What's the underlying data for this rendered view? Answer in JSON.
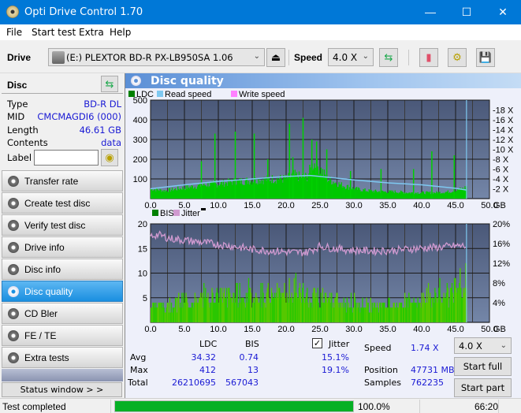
{
  "window": {
    "title": "Opti Drive Control 1.70",
    "controls": {
      "minimize": "—",
      "maximize": "☐",
      "close": "✕"
    }
  },
  "menu": [
    "File",
    "Start test",
    "Extra",
    "Help"
  ],
  "toolbar": {
    "drive_label": "Drive",
    "drive_value": "(E:)  PLEXTOR BD-R  PX-LB950SA 1.06",
    "speed_label": "Speed",
    "speed_value": "4.0 X",
    "icons": [
      "eject-icon",
      "refresh-icon",
      "eraser-icon",
      "settings-icon",
      "save-icon"
    ]
  },
  "disc": {
    "title": "Disc",
    "rows": [
      {
        "key": "Type",
        "value": "BD-R DL"
      },
      {
        "key": "MID",
        "value": "CMCMAGDI6 (000)"
      },
      {
        "key": "Length",
        "value": "46.61 GB"
      },
      {
        "key": "Contents",
        "value": "data"
      }
    ],
    "label_key": "Label",
    "label_value": ""
  },
  "nav": [
    {
      "label": "Transfer rate",
      "active": false
    },
    {
      "label": "Create test disc",
      "active": false
    },
    {
      "label": "Verify test disc",
      "active": false
    },
    {
      "label": "Drive info",
      "active": false
    },
    {
      "label": "Disc info",
      "active": false
    },
    {
      "label": "Disc quality",
      "active": true
    },
    {
      "label": "CD Bler",
      "active": false
    },
    {
      "label": "FE / TE",
      "active": false
    },
    {
      "label": "Extra tests",
      "active": false
    }
  ],
  "status_window_label": "Status window > >",
  "panel_title": "Disc quality",
  "colors": {
    "accent": "#0078d7",
    "ldc": "#00c800",
    "read_speed": "#7ec8f0",
    "write_speed": "#ff80ff",
    "bis": "#008000",
    "jitter": "#d09ad0",
    "progress": "#06b025",
    "value_text": "#1a1ad4"
  },
  "chart_data": [
    {
      "type": "bar",
      "title": "LDC / Read speed",
      "legend": [
        "LDC",
        "Read speed",
        "Write speed"
      ],
      "legend_position": "top-left",
      "xlabel": "GB",
      "x_ticks": [
        "0.0",
        "5.0",
        "10.0",
        "15.0",
        "20.0",
        "25.0",
        "30.0",
        "35.0",
        "40.0",
        "45.0",
        "50.0"
      ],
      "xlim": [
        0,
        50
      ],
      "y_left_ticks": [
        "100",
        "200",
        "300",
        "400",
        "500"
      ],
      "ylim_left": [
        0,
        500
      ],
      "y_right_ticks": [
        "2 X",
        "4 X",
        "6 X",
        "8 X",
        "10 X",
        "12 X",
        "14 X",
        "16 X",
        "18 X"
      ],
      "ylim_right": [
        0,
        20
      ],
      "grid": true,
      "end_marker_gb": 46.61,
      "series": [
        {
          "name": "LDC",
          "x": [
            0,
            2,
            4,
            6,
            8,
            10,
            12,
            14,
            16,
            18,
            20,
            21,
            22,
            23,
            24,
            25,
            26,
            28,
            30,
            32,
            34,
            36,
            38,
            40,
            42,
            44,
            46,
            46.6
          ],
          "values": [
            50,
            40,
            50,
            60,
            70,
            75,
            85,
            90,
            95,
            100,
            100,
            120,
            110,
            110,
            180,
            150,
            100,
            70,
            50,
            40,
            35,
            35,
            30,
            30,
            30,
            35,
            50,
            60
          ]
        },
        {
          "name": "LDC spikes",
          "x": [
            7.5,
            9.5,
            12.5,
            15.3,
            17.3,
            20.5,
            21,
            22.5,
            23.8,
            24.5,
            26,
            29.5,
            34,
            38.8,
            41.5,
            44.8
          ],
          "values": [
            190,
            330,
            340,
            330,
            200,
            380,
            210,
            410,
            300,
            290,
            250,
            140,
            150,
            150,
            240,
            220
          ]
        },
        {
          "name": "Read speed",
          "x": [
            0,
            5,
            10,
            15,
            20,
            23.5,
            25,
            30,
            35,
            40,
            45,
            46.6
          ],
          "values": [
            2.0,
            2.8,
            3.5,
            4.0,
            4.5,
            4.7,
            4.5,
            3.8,
            3.2,
            2.8,
            2.1,
            1.74
          ]
        }
      ]
    },
    {
      "type": "bar",
      "title": "BIS / Jitter",
      "legend": [
        "BIS",
        "Jitter"
      ],
      "legend_position": "top-left",
      "xlabel": "GB",
      "x_ticks": [
        "0.0",
        "5.0",
        "10.0",
        "15.0",
        "20.0",
        "25.0",
        "30.0",
        "35.0",
        "40.0",
        "45.0",
        "50.0"
      ],
      "xlim": [
        0,
        50
      ],
      "y_left_ticks": [
        "5",
        "10",
        "15",
        "20"
      ],
      "ylim_left": [
        0,
        20
      ],
      "y_right_ticks": [
        "4%",
        "8%",
        "12%",
        "16%",
        "20%"
      ],
      "ylim_right": [
        0,
        20
      ],
      "grid": true,
      "series": [
        {
          "name": "BIS",
          "x": [
            0,
            3,
            6,
            9,
            12,
            15,
            18,
            21,
            24,
            27,
            30,
            33,
            36,
            39,
            42,
            45,
            46.6
          ],
          "values": [
            4,
            4,
            5,
            6,
            6,
            6,
            6,
            7,
            6,
            5,
            4,
            4,
            4,
            5,
            6,
            7,
            9
          ]
        },
        {
          "name": "Jitter",
          "x": [
            0,
            1,
            3,
            6,
            9,
            12,
            15,
            18,
            21,
            23,
            25,
            27,
            30,
            33,
            36,
            39,
            42,
            45,
            46.6
          ],
          "values": [
            17.5,
            17.8,
            17.0,
            16.5,
            16.0,
            15.5,
            14.8,
            14.5,
            14.2,
            14.2,
            15.5,
            15.0,
            14.6,
            14.5,
            14.6,
            15.0,
            15.2,
            15.5,
            15.5
          ]
        }
      ]
    }
  ],
  "stats": {
    "col_ldc": "LDC",
    "col_bis": "BIS",
    "jitter_label": "Jitter",
    "jitter_checked": true,
    "rows": [
      {
        "label": "Avg",
        "ldc": "34.32",
        "bis": "0.74",
        "jitter": "15.1%"
      },
      {
        "label": "Max",
        "ldc": "412",
        "bis": "13",
        "jitter": "19.1%"
      },
      {
        "label": "Total",
        "ldc": "26210695",
        "bis": "567043",
        "jitter": ""
      }
    ],
    "speed_label": "Speed",
    "speed_value": "1.74 X",
    "position_label": "Position",
    "position_value": "47731 MB",
    "samples_label": "Samples",
    "samples_value": "762235",
    "speed_select": "4.0 X",
    "start_full": "Start full",
    "start_part": "Start part"
  },
  "statusbar": {
    "text": "Test completed",
    "progress": 100.0,
    "progress_text": "100.0%",
    "time": "66:20"
  }
}
